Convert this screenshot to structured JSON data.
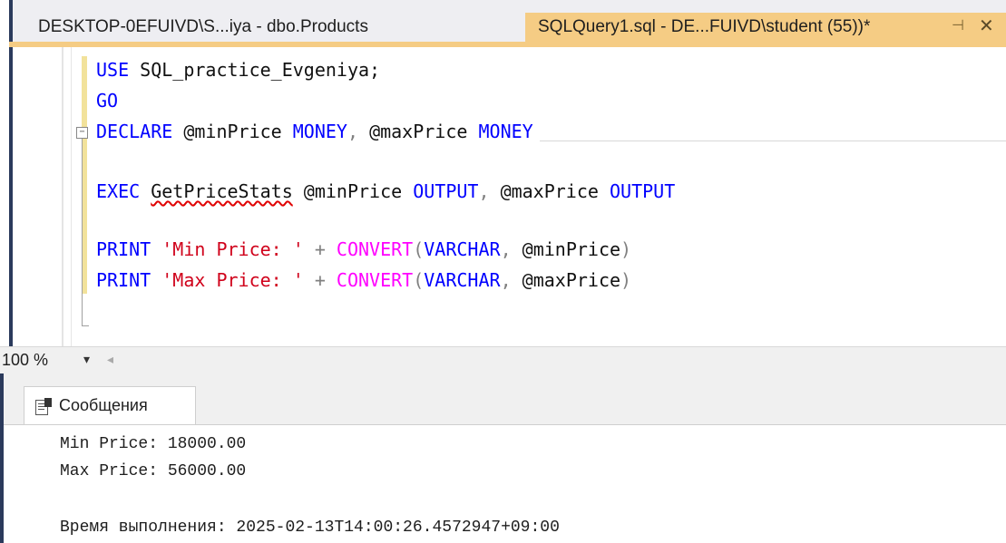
{
  "tabs": {
    "inactive_label": "DESKTOP-0EFUIVD\\S...iya - dbo.Products",
    "active_label": "SQLQuery1.sql - DE...FUIVD\\student (55))*",
    "pin_glyph": "⊣",
    "close_glyph": "✕"
  },
  "editor": {
    "line1": {
      "kw": "USE",
      "rest": " SQL_practice_Evgeniya;"
    },
    "line2": {
      "kw": "GO"
    },
    "line3": {
      "kw1": "DECLARE",
      "v1": " @minPrice ",
      "t1": "MONEY",
      "sep": ", ",
      "v2": "@maxPrice ",
      "t2": "MONEY"
    },
    "line4": {
      "kw": "EXEC",
      "sp": " ",
      "proc": "GetPriceStats",
      "v1": " @minPrice ",
      "o1": "OUTPUT",
      "sep": ", ",
      "v2": "@maxPrice ",
      "o2": "OUTPUT"
    },
    "line5": {
      "kw": "PRINT",
      "str": " 'Min Price: '",
      "plus": " + ",
      "fn": "CONVERT",
      "open": "(",
      "type": "VARCHAR",
      "sep": ", ",
      "var": "@minPrice",
      "close": ")"
    },
    "line6": {
      "kw": "PRINT",
      "str": " 'Max Price: '",
      "plus": " + ",
      "fn": "CONVERT",
      "open": "(",
      "type": "VARCHAR",
      "sep": ", ",
      "var": "@maxPrice",
      "close": ")"
    },
    "outline_glyph": "−"
  },
  "zoombar": {
    "zoom": "100 %",
    "dropdown_glyph": "▾",
    "scroll_glyph": "◂"
  },
  "results": {
    "tab_label": "Сообщения",
    "messages": [
      "Min Price: 18000.00",
      "Max Price: 56000.00",
      "",
      "Время выполнения: 2025-02-13T14:00:26.4572947+09:00"
    ]
  },
  "colors": {
    "keyword": "#0000ff",
    "string": "#d0021b",
    "function": "#ff00ff",
    "active_tab": "#f5cc84"
  }
}
